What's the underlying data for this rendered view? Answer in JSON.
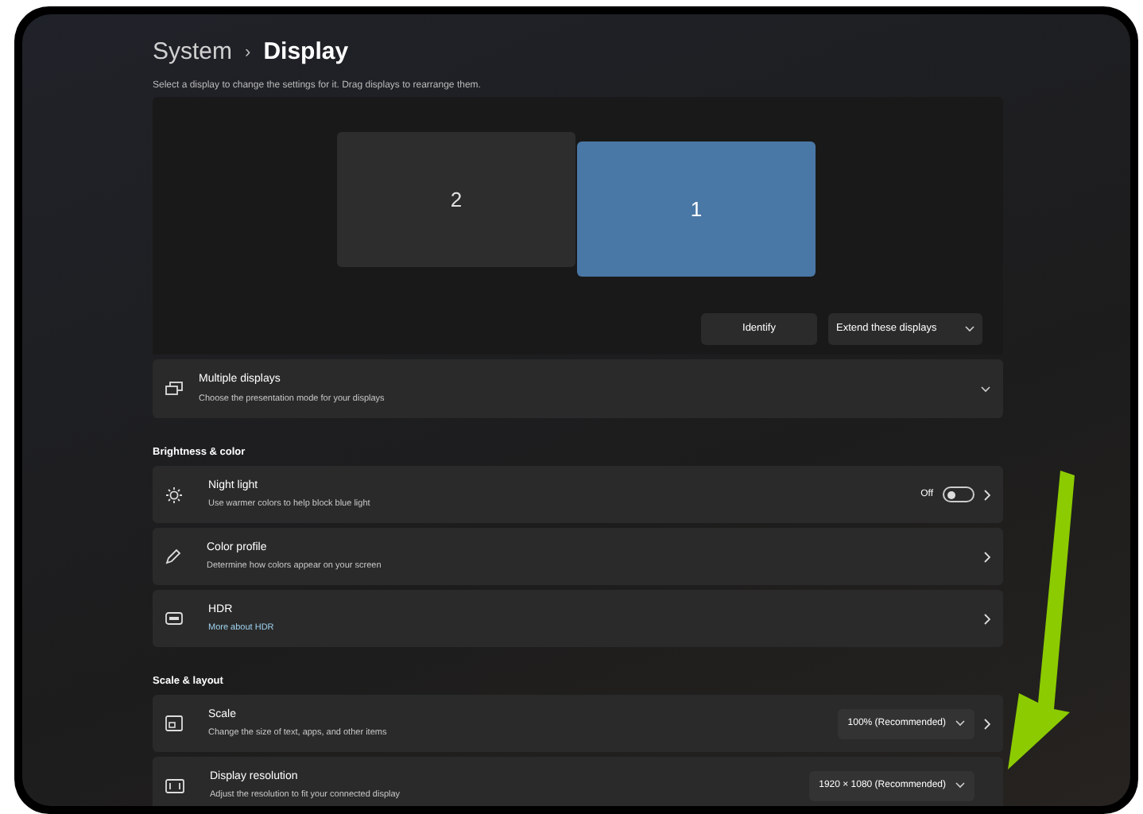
{
  "breadcrumb": {
    "parent": "System",
    "separator": "›",
    "current": "Display"
  },
  "description": "Select a display to change the settings for it. Drag displays to rearrange them.",
  "displays": [
    {
      "label": "2",
      "selected": false
    },
    {
      "label": "1",
      "selected": true
    }
  ],
  "identify_button": "Identify",
  "mode_dropdown": {
    "value": "Extend these displays"
  },
  "multiple_displays": {
    "title": "Multiple displays",
    "subtitle": "Choose the presentation mode for your displays",
    "expanded": false
  },
  "sections": [
    {
      "heading": "Brightness & color",
      "items": [
        {
          "kind": "toggle",
          "title": "Night light",
          "subtitle": "Use warmer colors to help block blue light",
          "state_label": "Off",
          "on": false
        },
        {
          "kind": "plain",
          "title": "Color profile",
          "subtitle": "Determine how colors appear on your screen"
        },
        {
          "kind": "link",
          "title": "HDR",
          "link": "More about HDR"
        }
      ]
    },
    {
      "heading": "Scale & layout",
      "items": [
        {
          "kind": "dropdown",
          "title": "Scale",
          "subtitle": "Change the size of text, apps, and other items",
          "value": "100% (Recommended)",
          "chevron": true
        },
        {
          "kind": "dropdown",
          "title": "Display resolution",
          "subtitle": "Adjust the resolution to fit your connected display",
          "value": "1920 × 1080 (Recommended)",
          "chevron": false
        }
      ]
    }
  ]
}
